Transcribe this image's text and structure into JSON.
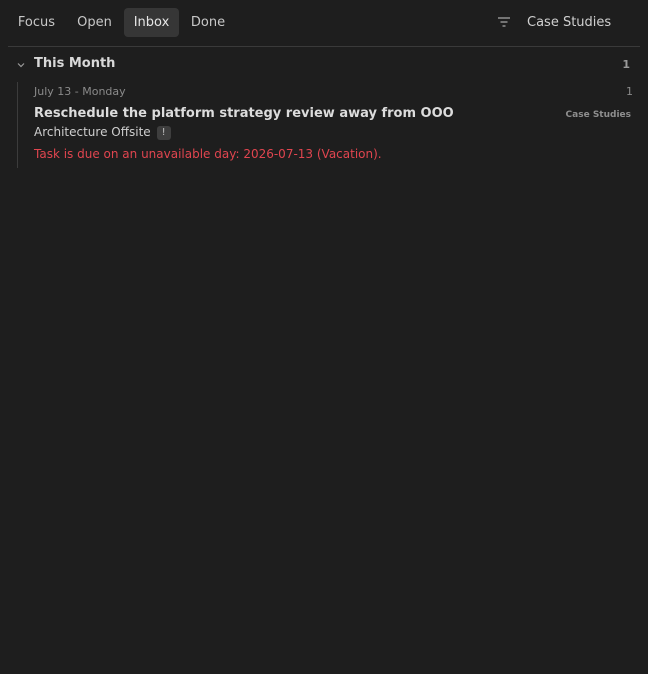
{
  "tabs": [
    {
      "label": "Focus",
      "active": false
    },
    {
      "label": "Open",
      "active": false
    },
    {
      "label": "Inbox",
      "active": true
    },
    {
      "label": "Done",
      "active": false
    }
  ],
  "filter": {
    "icon": "filter-icon",
    "view_label": "Case Studies"
  },
  "group": {
    "title": "This Month",
    "count": "1",
    "icon": "chevron-down-icon",
    "date_heading": "July 13 - Monday",
    "date_count": "1",
    "task": {
      "title": "Reschedule the platform strategy review away from OOO",
      "project": "Case Studies",
      "context": "Architecture Offsite",
      "priority_badge": "!",
      "warning": "Task is due on an unavailable day: 2026-07-13 (Vacation)."
    }
  },
  "colors": {
    "background": "#1e1e1e",
    "active_tab_bg": "#363636",
    "warning": "#e0454f"
  }
}
